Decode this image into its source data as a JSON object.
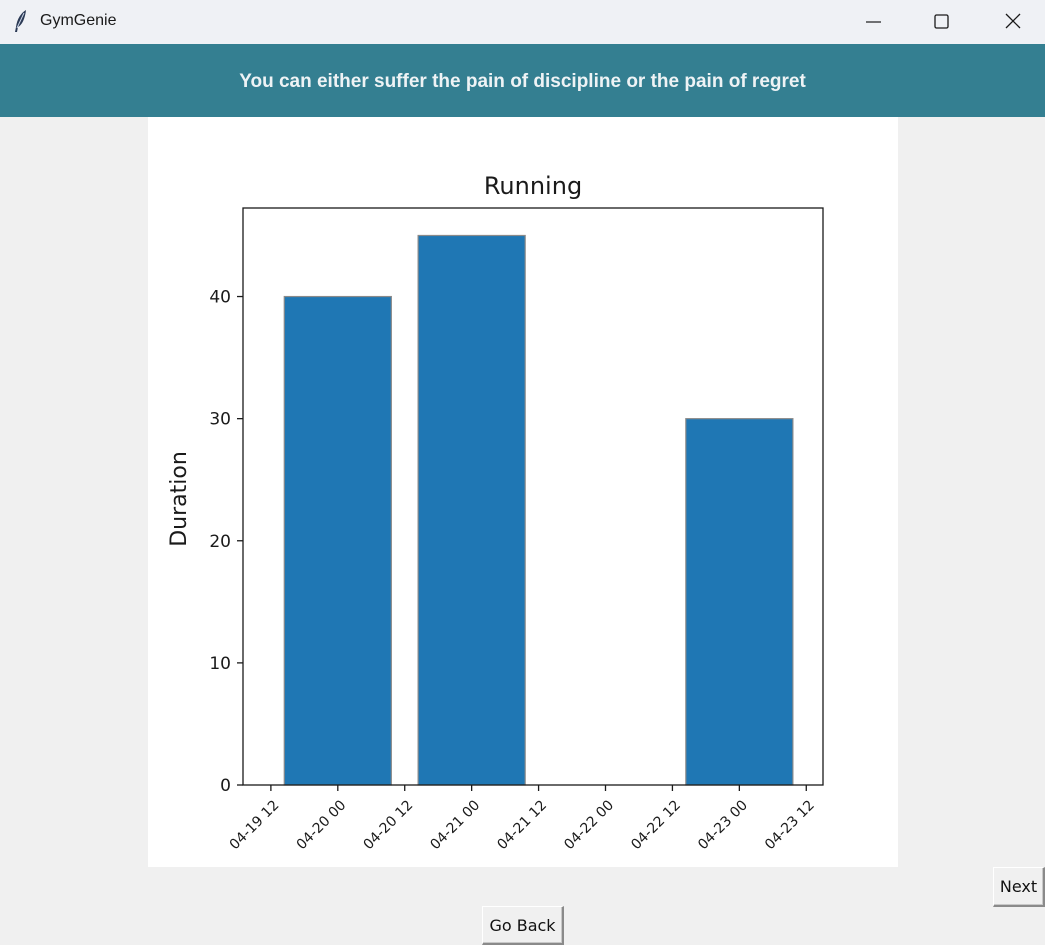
{
  "window": {
    "title": "GymGenie",
    "icon": "feather-icon",
    "controls": [
      "minimize-icon",
      "maximize-icon",
      "close-icon"
    ]
  },
  "banner": {
    "text": "You can either suffer the pain of discipline or the pain of regret",
    "color": "#347f91"
  },
  "buttons": {
    "next": "Next",
    "back": "Go Back"
  },
  "chart_data": {
    "type": "bar",
    "title": "Running",
    "xlabel": "",
    "ylabel": "Duration",
    "x_ticks": [
      "04-19 12",
      "04-20 00",
      "04-20 12",
      "04-21 00",
      "04-21 12",
      "04-22 00",
      "04-22 12",
      "04-23 00",
      "04-23 12"
    ],
    "y_ticks": [
      0,
      10,
      20,
      30,
      40
    ],
    "xlim": [
      "04-19 07:00",
      "04-23 15:00"
    ],
    "ylim": [
      0,
      47.25
    ],
    "bars": [
      {
        "date": "04-20 00",
        "value": 40
      },
      {
        "date": "04-21 00",
        "value": 45
      },
      {
        "date": "04-23 00",
        "value": 30
      }
    ],
    "bar_width_days": 0.8,
    "bar_color": "#1f77b4",
    "grid": false,
    "legend": "none"
  }
}
